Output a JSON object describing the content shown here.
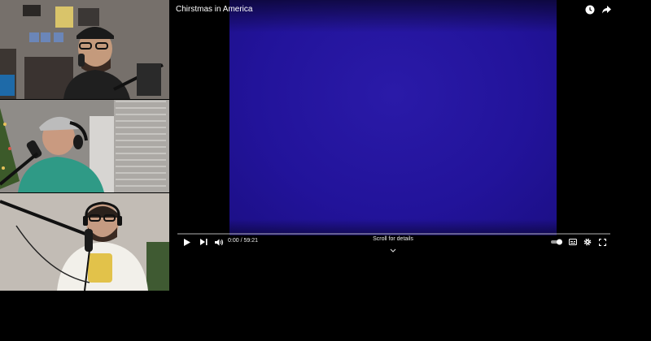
{
  "participants": [
    {
      "name": "participant-top"
    },
    {
      "name": "participant-middle"
    },
    {
      "name": "participant-bottom"
    }
  ],
  "player": {
    "title": "Chirstmas in America",
    "current_time": "0:00",
    "duration": "59:21",
    "time_separator": " / ",
    "scroll_hint": "Scroll for details",
    "progress_fraction": 0.0,
    "accent_color": "#ff0000",
    "video_color": "#22139a"
  },
  "icons": {
    "watch_later": "clock-icon",
    "share": "share-arrow-icon",
    "play": "play-icon",
    "next": "next-icon",
    "volume": "volume-icon",
    "autoplay": "autoplay-toggle-icon",
    "subtitles": "subtitles-icon",
    "settings": "gear-icon",
    "fullscreen": "fullscreen-icon",
    "chevron": "chevron-down-icon"
  }
}
